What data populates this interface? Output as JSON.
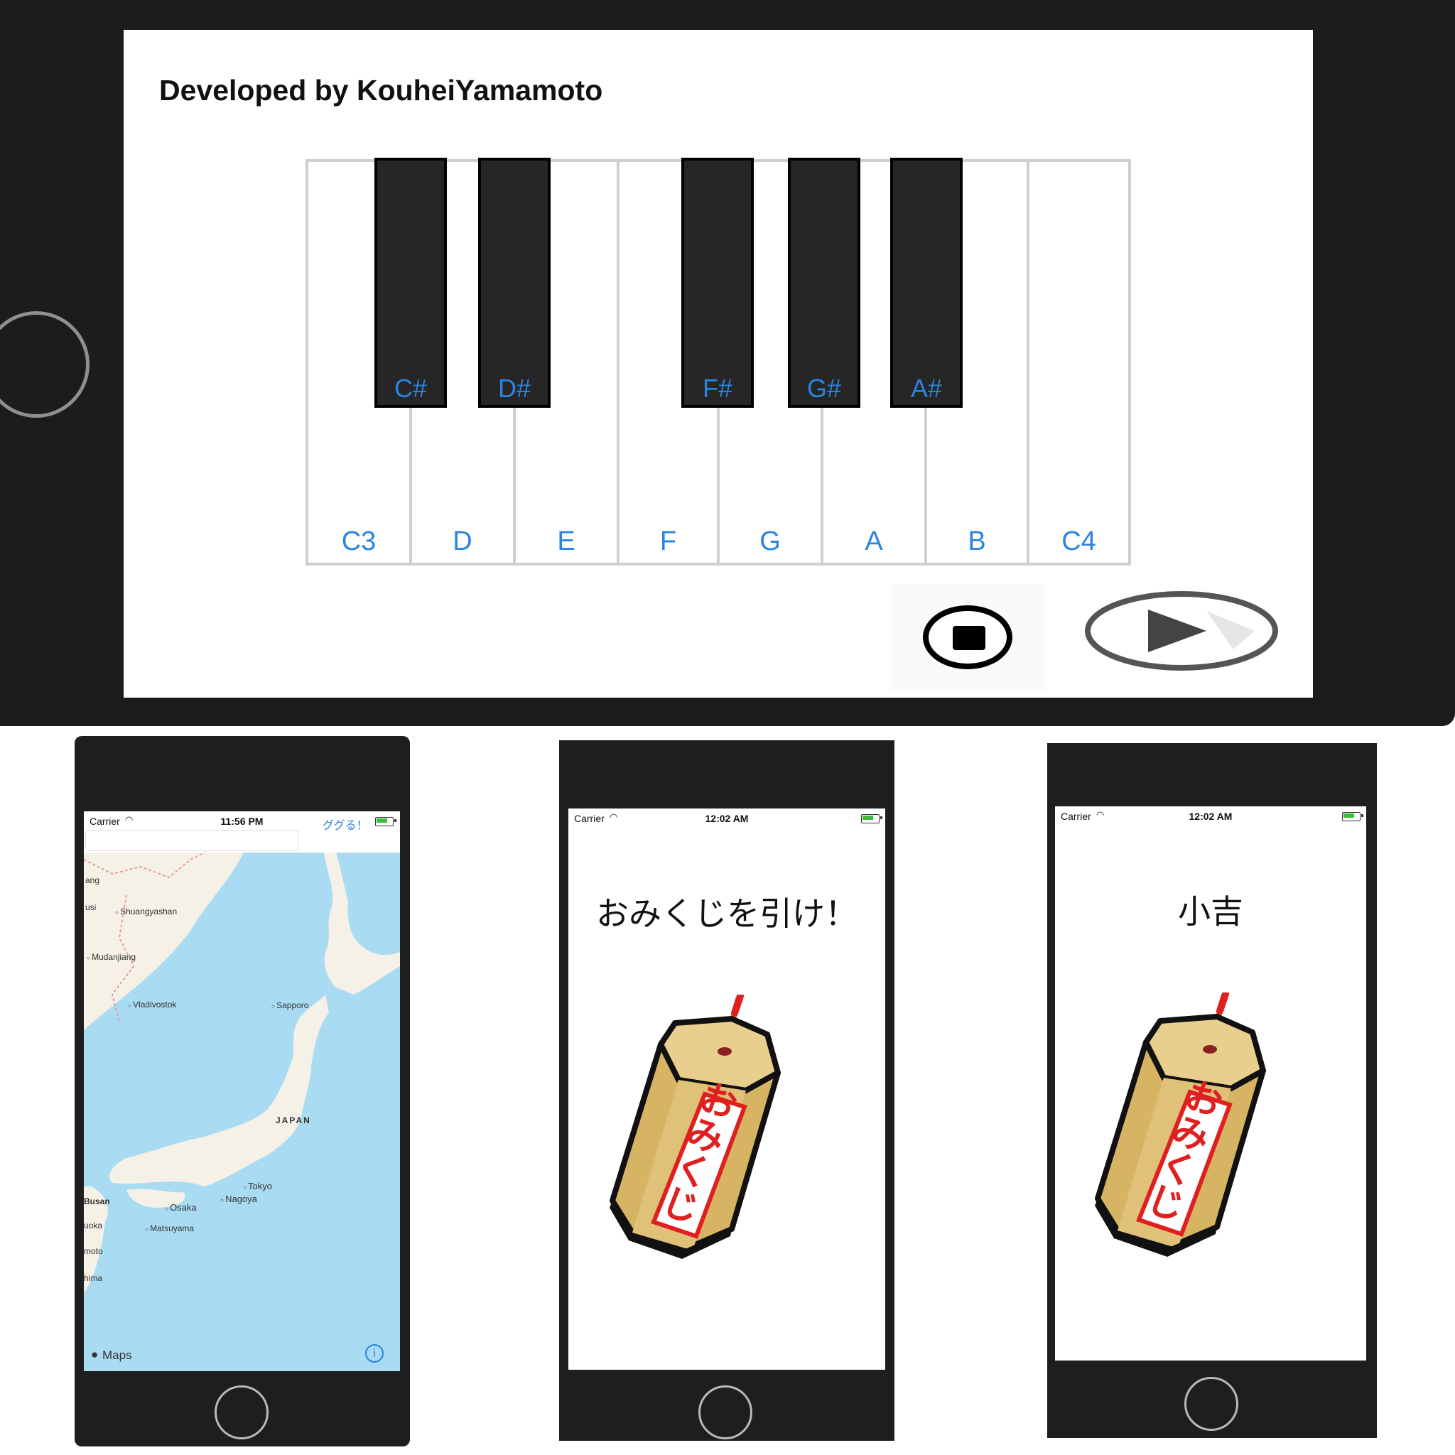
{
  "piano_app": {
    "credit": "Developed by KouheiYamamoto",
    "white_keys": [
      "C3",
      "D",
      "E",
      "F",
      "G",
      "A",
      "B",
      "C4"
    ],
    "black_keys": [
      "C#",
      "D#",
      "F#",
      "G#",
      "A#"
    ],
    "stop_icon": "stop-icon",
    "play_icon": "play-icon"
  },
  "map_app": {
    "status": {
      "carrier": "Carrier",
      "time": "11:56 PM"
    },
    "search_button": "ググる！",
    "search_placeholder": "",
    "labels": {
      "shuangyashan": "Shuangyashan",
      "mudanjiang": "Mudanjiang",
      "vladivostok": "Vladivostok",
      "sapporo": "Sapporo",
      "japan": "JAPAN",
      "tokyo": "Tokyo",
      "nagoya": "Nagoya",
      "osaka": "Osaka",
      "busan": "Busan",
      "matsuyama": "Matsuyama",
      "edge1": "ang",
      "edge2": "usi",
      "edge3": "uoka",
      "edge4": "moto",
      "edge5": "hima"
    },
    "maps_logo": "Maps",
    "info_icon": "info-icon",
    "colors": {
      "water": "#a9dcf3",
      "land": "#f6f1e7",
      "border": "#e3a0a0"
    }
  },
  "omikuji_app_1": {
    "status": {
      "carrier": "Carrier",
      "time": "12:02 AM"
    },
    "title": "おみくじを引け！",
    "box_label": "おみくじ"
  },
  "omikuji_app_2": {
    "status": {
      "carrier": "Carrier",
      "time": "12:02 AM"
    },
    "title": "小吉",
    "box_label": "おみくじ"
  }
}
